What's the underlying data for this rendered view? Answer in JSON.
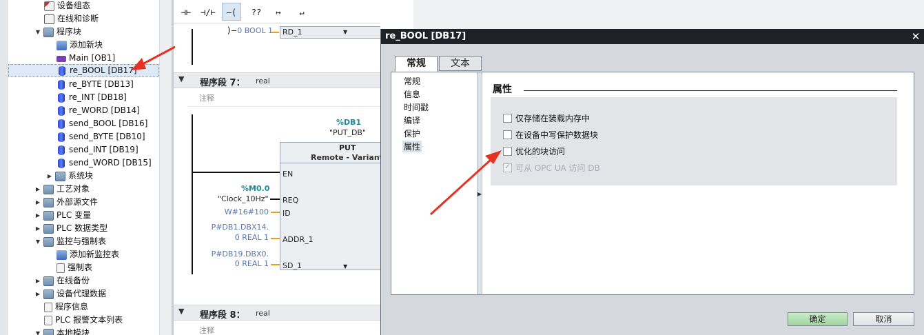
{
  "tree": {
    "items": [
      {
        "label": "设备组态"
      },
      {
        "label": "在线和诊断"
      },
      {
        "label": "程序块"
      },
      {
        "label": "添加新块"
      },
      {
        "label": "Main [OB1]"
      },
      {
        "label": "re_BOOL [DB17]"
      },
      {
        "label": "re_BYTE [DB13]"
      },
      {
        "label": "re_INT [DB18]"
      },
      {
        "label": "re_WORD [DB14]"
      },
      {
        "label": "send_BOOL [DB16]"
      },
      {
        "label": "send_BYTE [DB10]"
      },
      {
        "label": "send_INT [DB19]"
      },
      {
        "label": "send_WORD [DB15]"
      },
      {
        "label": "系统块"
      },
      {
        "label": "工艺对象"
      },
      {
        "label": "外部源文件"
      },
      {
        "label": "PLC 变量"
      },
      {
        "label": "PLC 数据类型"
      },
      {
        "label": "监控与强制表"
      },
      {
        "label": "添加新监控表"
      },
      {
        "label": "强制表"
      },
      {
        "label": "在线备份"
      },
      {
        "label": "设备代理数据"
      },
      {
        "label": "程序信息"
      },
      {
        "label": "PLC 报警文本列表"
      },
      {
        "label": "本地模块"
      }
    ]
  },
  "toolbar": {
    "buttons": [
      "⊣⊢",
      "⊣/⊢",
      "–( )–",
      "??",
      "↦",
      "↵"
    ]
  },
  "editor": {
    "top_value": "0 BOOL 1",
    "top_param": "RD_1",
    "network7": {
      "title": "程序段 7：",
      "sub": "real",
      "comment": "注释"
    },
    "db_addr": "%DB1",
    "db_name": "\"PUT_DB\"",
    "block_name": "PUT",
    "block_sub": "Remote  -  Variant",
    "en": "EN",
    "m_addr": "%M0.0",
    "clock": "\"Clock_10Hz\"",
    "req": "REQ",
    "id_val": "W#16#100",
    "id": "ID",
    "addr1_val1": "P#DB1.DBX14.",
    "addr1_val2": "0 REAL 1",
    "addr1": "ADDR_1",
    "sd1_val1": "P#DB19.DBX0.",
    "sd1_val2": "0 REAL 1",
    "sd1": "SD_1",
    "network8": {
      "title": "程序段 8：",
      "sub": "real",
      "comment": "注释"
    }
  },
  "dialog": {
    "title": "re_BOOL [DB17]",
    "close": "✕",
    "tabs": [
      "常规",
      "文本"
    ],
    "nav": [
      "常规",
      "信息",
      "时间戳",
      "编译",
      "保护",
      "属性"
    ],
    "selected_nav": "属性",
    "section_title": "属性",
    "options": [
      {
        "label": "仅存储在装载内存中",
        "checked": false,
        "disabled": false
      },
      {
        "label": "在设备中写保护数据块",
        "checked": false,
        "disabled": false
      },
      {
        "label": "优化的块访问",
        "checked": false,
        "disabled": false
      },
      {
        "label": "可从 OPC UA 访问 DB",
        "checked": true,
        "disabled": true
      }
    ],
    "ok": "确定",
    "cancel": "取消"
  },
  "colors": {
    "annotation": "#e53222",
    "ok_button": "#a8dca8",
    "title_bar": "#1f2327"
  }
}
